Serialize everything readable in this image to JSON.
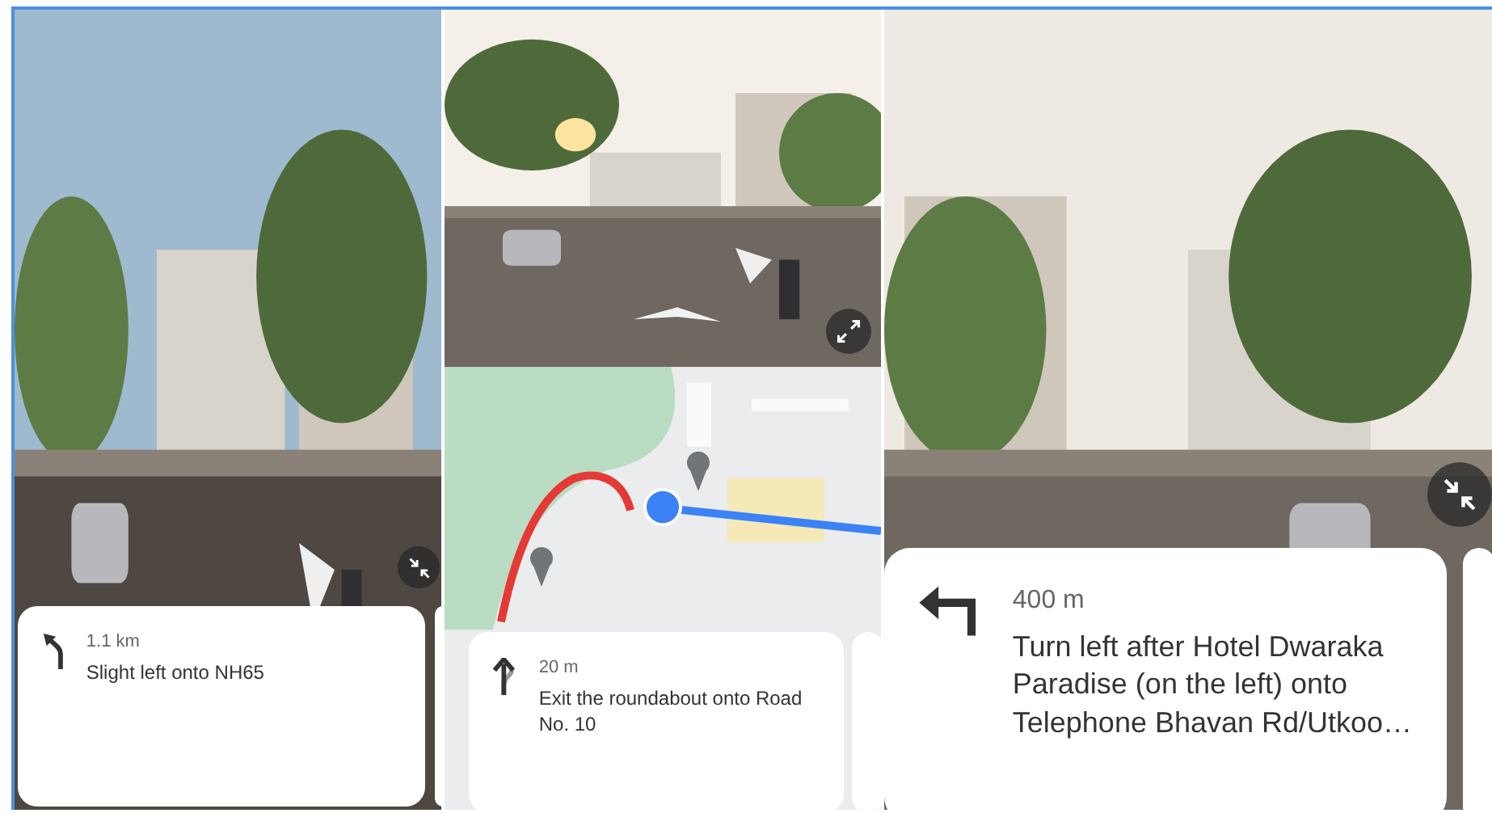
{
  "panels": [
    {
      "views": [
        {
          "kind": "street"
        }
      ],
      "control": {
        "kind": "collapse"
      },
      "card": {
        "distance": "1.1 km",
        "instruction": "Slight left onto NH65",
        "kind": "slight-left"
      }
    },
    {
      "views": [
        {
          "kind": "street"
        },
        {
          "kind": "map"
        }
      ],
      "control": {
        "kind": "expand"
      },
      "card": {
        "distance": "20 m",
        "instruction": "Exit the roundabout onto Road No. 10",
        "kind": "roundabout-exit"
      }
    },
    {
      "views": [
        {
          "kind": "street"
        }
      ],
      "control": {
        "kind": "collapse"
      },
      "card": {
        "distance": "400 m",
        "instruction": "Turn left after Hotel Dwaraka Paradise (on the left) onto Telephone Bhavan Rd/Utkoo…",
        "kind": "turn-left"
      }
    }
  ]
}
